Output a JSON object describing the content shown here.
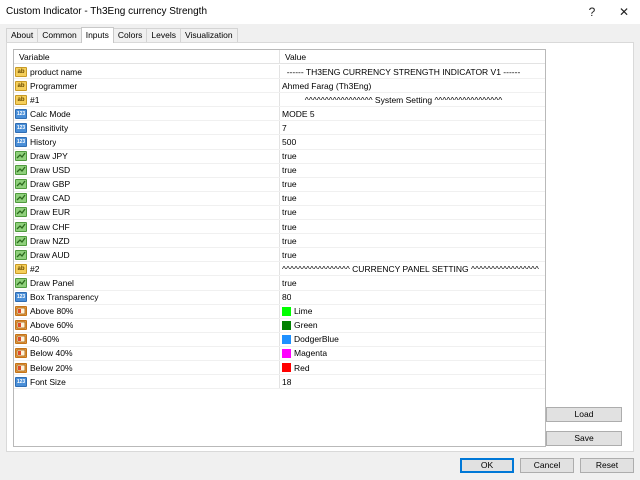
{
  "window": {
    "title": "Custom Indicator - Th3Eng currency Strength",
    "help_glyph": "?",
    "close_glyph": "✕"
  },
  "tabs": [
    {
      "label": "About"
    },
    {
      "label": "Common"
    },
    {
      "label": "Inputs"
    },
    {
      "label": "Colors"
    },
    {
      "label": "Levels"
    },
    {
      "label": "Visualization"
    }
  ],
  "active_tab": "Inputs",
  "grid": {
    "header_variable": "Variable",
    "header_value": "Value",
    "rows": [
      {
        "icon": "ab",
        "variable": "product name",
        "value": "------  TH3ENG CURRENCY STRENGTH INDICATOR V1  ------",
        "center": true
      },
      {
        "icon": "ab",
        "variable": "Programmer",
        "value": "Ahmed Farag (Th3Eng)"
      },
      {
        "icon": "ab",
        "variable": "#1",
        "value": "^^^^^^^^^^^^^^^^^ System Setting ^^^^^^^^^^^^^^^^^",
        "center": true
      },
      {
        "icon": "num",
        "variable": "Calc Mode",
        "value": "MODE 5"
      },
      {
        "icon": "num",
        "variable": "Sensitivity",
        "value": "7"
      },
      {
        "icon": "num",
        "variable": "History",
        "value": "500"
      },
      {
        "icon": "bool",
        "variable": "Draw JPY",
        "value": "true"
      },
      {
        "icon": "bool",
        "variable": "Draw USD",
        "value": "true"
      },
      {
        "icon": "bool",
        "variable": "Draw GBP",
        "value": "true"
      },
      {
        "icon": "bool",
        "variable": "Draw CAD",
        "value": "true"
      },
      {
        "icon": "bool",
        "variable": "Draw EUR",
        "value": "true"
      },
      {
        "icon": "bool",
        "variable": "Draw CHF",
        "value": "true"
      },
      {
        "icon": "bool",
        "variable": "Draw NZD",
        "value": "true"
      },
      {
        "icon": "bool",
        "variable": "Draw AUD",
        "value": "true"
      },
      {
        "icon": "ab",
        "variable": "#2",
        "value": "^^^^^^^^^^^^^^^^^ CURRENCY PANEL SETTING ^^^^^^^^^^^^^^^^^",
        "center": true
      },
      {
        "icon": "bool",
        "variable": "Draw Panel",
        "value": "true"
      },
      {
        "icon": "num",
        "variable": "Box Transparency",
        "value": "80"
      },
      {
        "icon": "color",
        "variable": "Above 80%",
        "value": "Lime",
        "swatch": "#00ff00"
      },
      {
        "icon": "color",
        "variable": "Above 60%",
        "value": "Green",
        "swatch": "#008000"
      },
      {
        "icon": "color",
        "variable": "40-60%",
        "value": "DodgerBlue",
        "swatch": "#1e90ff"
      },
      {
        "icon": "color",
        "variable": "Below 40%",
        "value": "Magenta",
        "swatch": "#ff00ff"
      },
      {
        "icon": "color",
        "variable": "Below 20%",
        "value": "Red",
        "swatch": "#ff0000"
      },
      {
        "icon": "num",
        "variable": "Font Size",
        "value": "18"
      }
    ]
  },
  "side_buttons": {
    "load": "Load",
    "save": "Save"
  },
  "footer_buttons": {
    "ok": "OK",
    "cancel": "Cancel",
    "reset": "Reset"
  }
}
